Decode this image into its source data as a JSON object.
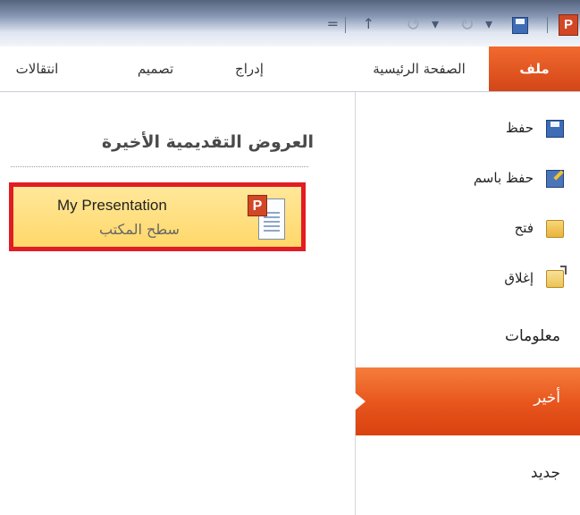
{
  "qat": {
    "customize_glyph": "=",
    "touch_mode_glyph": "↑",
    "undo_glyph": "↺",
    "redo_glyph": "↻",
    "app_logo_letter": "P"
  },
  "ribbon_tabs": [
    {
      "label": "ملف"
    },
    {
      "label": "الصفحة الرئيسية"
    },
    {
      "label": "إدراج"
    },
    {
      "label": "تصميم"
    },
    {
      "label": "انتقالات"
    }
  ],
  "nav": {
    "save": "حفظ",
    "save_as": "حفظ باسم",
    "open": "فتح",
    "close": "إغلاق",
    "info": "معلومات",
    "recent": "أخير",
    "new": "جديد"
  },
  "recent": {
    "title": "العروض التقديمية الأخيرة",
    "items": [
      {
        "name": "My Presentation",
        "location": "سطح المكتب",
        "badge_letter": "P"
      }
    ]
  },
  "colors": {
    "accent_orange": "#e7541c",
    "highlight_border": "#e21c24",
    "recent_item_bg": "#ffe08a"
  }
}
